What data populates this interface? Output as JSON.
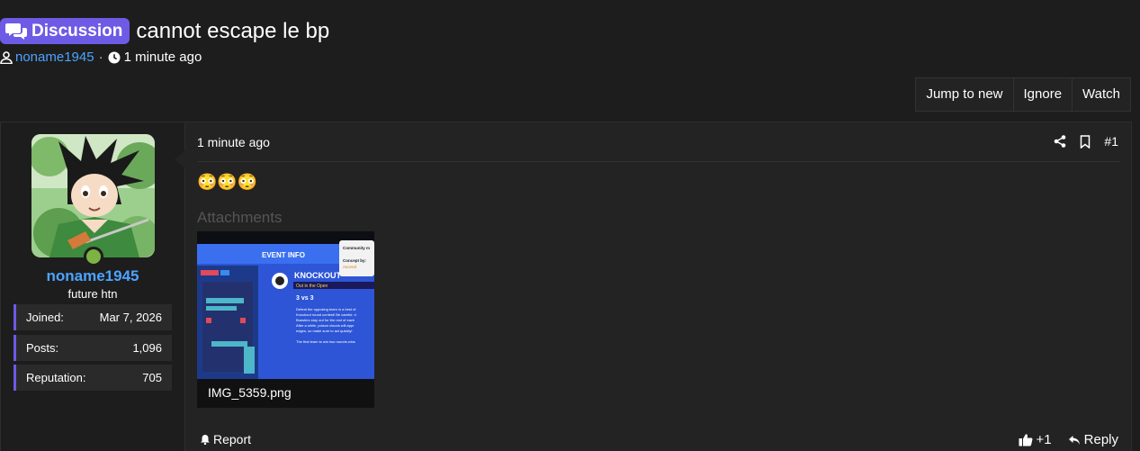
{
  "thread": {
    "badge_label": "Discussion",
    "title": "cannot escape le bp",
    "author": "noname1945",
    "separator": "·",
    "time": "1 minute ago"
  },
  "actions": {
    "jump": "Jump to new",
    "ignore": "Ignore",
    "watch": "Watch"
  },
  "user": {
    "name": "noname1945",
    "title": "future htn",
    "stats": [
      {
        "label": "Joined:",
        "value": "Mar 7, 2026"
      },
      {
        "label": "Posts:",
        "value": "1,096"
      },
      {
        "label": "Reputation:",
        "value": "705"
      }
    ]
  },
  "post": {
    "time": "1 minute ago",
    "number": "#1",
    "content": "😳😳😳",
    "attachments_heading": "Attachments",
    "attachment": {
      "filename": "IMG_5359.png",
      "preview_text": {
        "event_info": "EVENT INFO",
        "knockout": "KNOCKOUT",
        "subtitle": "Out in the Open",
        "mode": "3 vs 3",
        "community": "Community m",
        "concept": "Concept by:",
        "concept_author": "Ascend",
        "desc": [
          "Defeat the opposing team in a best of",
          "Knockout round contest! Be careful: d",
          "Brawlers stay out for the rest of each",
          "After a while, poison clouds will appr",
          "edges, so make sure to act quickly!",
          "",
          "The first team to win two rounds wins"
        ]
      }
    },
    "report_label": "Report",
    "reaction_count": "+1",
    "reply_label": "Reply"
  },
  "colors": {
    "accent": "#6d5be6",
    "link": "#4da3ff",
    "online": "#7cb342"
  }
}
